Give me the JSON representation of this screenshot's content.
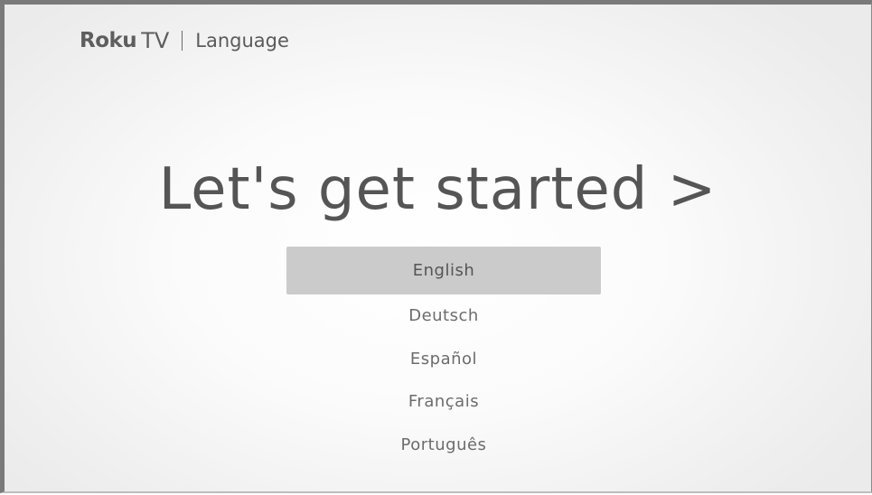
{
  "header": {
    "brand": "Roku",
    "brand_suffix": "TV",
    "section": "Language"
  },
  "main": {
    "headline": "Let's get started >"
  },
  "languages": {
    "selected_index": 0,
    "items": [
      {
        "label": "English"
      },
      {
        "label": "Deutsch"
      },
      {
        "label": "Español"
      },
      {
        "label": "Français"
      },
      {
        "label": "Português"
      }
    ]
  }
}
